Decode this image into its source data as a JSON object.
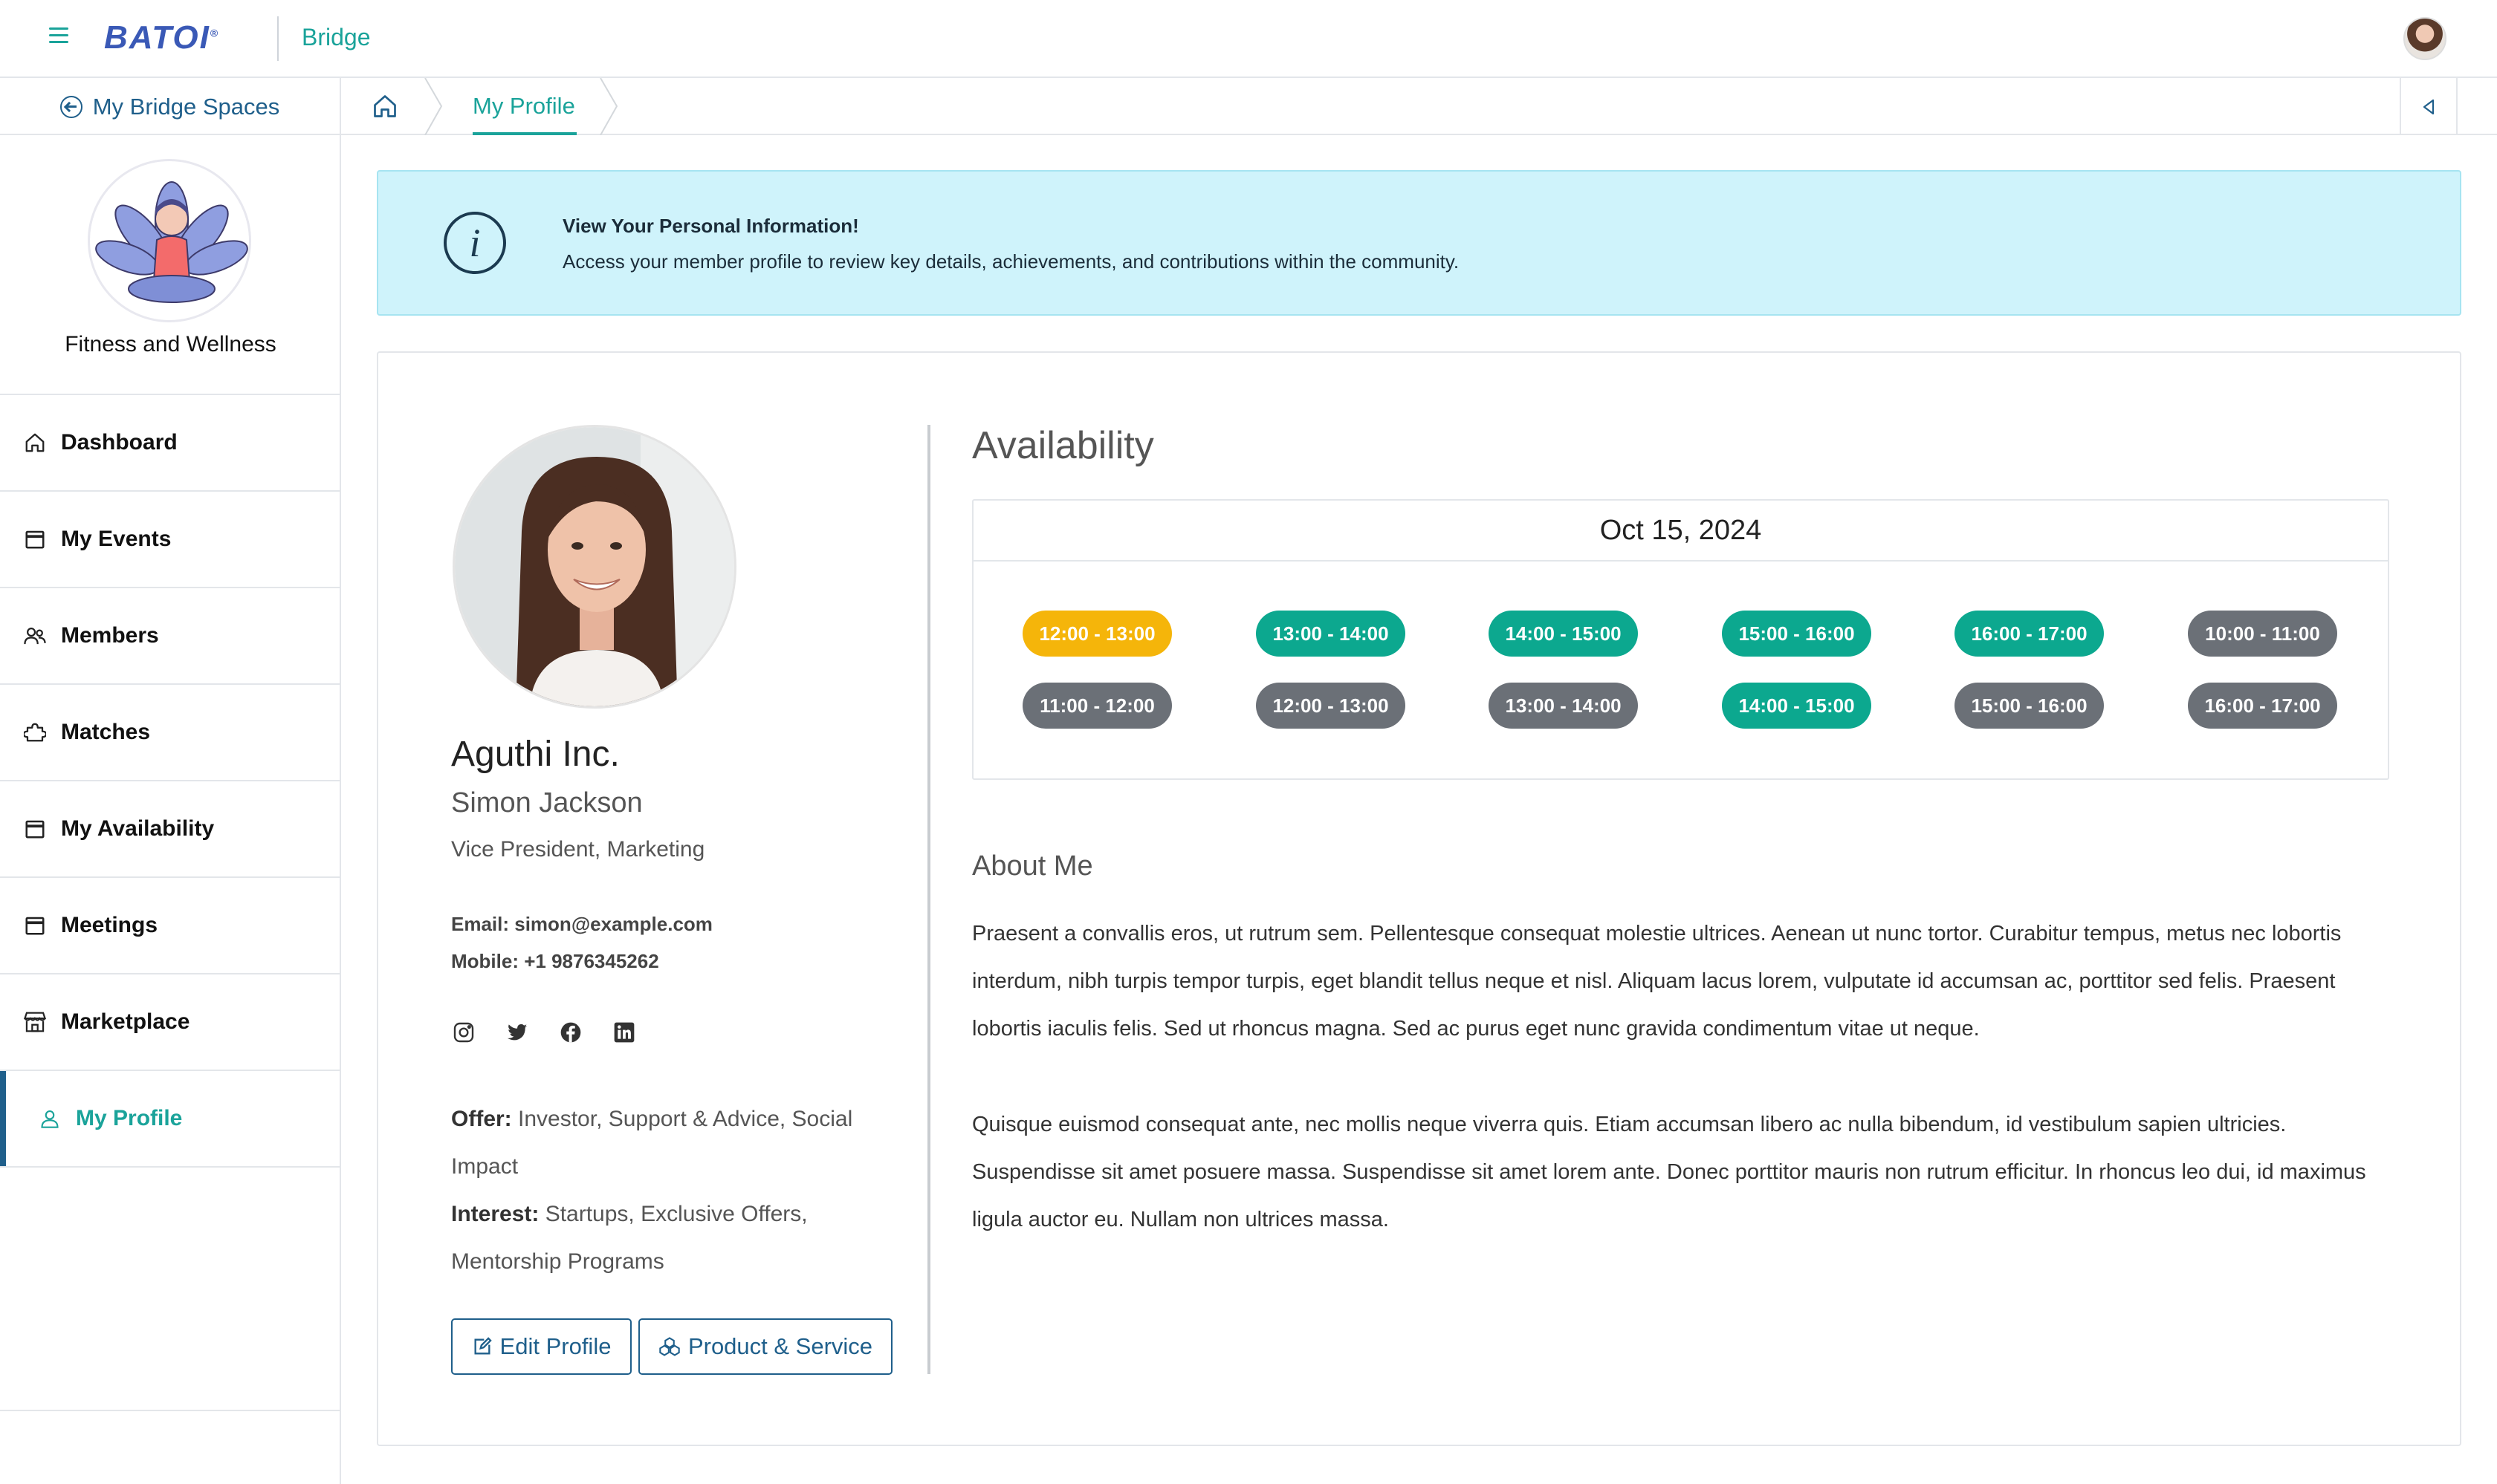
{
  "app": {
    "logo_text": "BATOI",
    "name": "Bridge"
  },
  "subbar": {
    "back_label": "My Bridge Spaces",
    "breadcrumb_current": "My Profile"
  },
  "sidebar": {
    "space_name": "Fitness and Wellness",
    "items": [
      {
        "label": "Dashboard",
        "icon": "home-icon"
      },
      {
        "label": "My Events",
        "icon": "calendar-icon"
      },
      {
        "label": "Members",
        "icon": "users-icon"
      },
      {
        "label": "Matches",
        "icon": "puzzle-icon"
      },
      {
        "label": "My Availability",
        "icon": "calendar-icon"
      },
      {
        "label": "Meetings",
        "icon": "calendar-icon"
      },
      {
        "label": "Marketplace",
        "icon": "store-icon"
      },
      {
        "label": "My Profile",
        "icon": "user-icon",
        "active": true
      }
    ]
  },
  "banner": {
    "title": "View Your Personal Information!",
    "text": "Access your member profile to review key details, achievements, and contributions within the community."
  },
  "profile": {
    "company": "Aguthi Inc.",
    "name": "Simon Jackson",
    "job_title": "Vice President, Marketing",
    "email": "Email: simon@example.com",
    "mobile": "Mobile: +1 9876345262",
    "socials": [
      "instagram-icon",
      "twitter-icon",
      "facebook-icon",
      "linkedin-icon"
    ],
    "offer_label": "Offer:",
    "offer_value": " Investor, Support & Advice, Social Impact",
    "interest_label": "Interest:",
    "interest_value": " Startups, Exclusive Offers, Mentorship Programs",
    "edit_button": "Edit Profile",
    "product_button": "Product & Service"
  },
  "availability": {
    "title": "Availability",
    "date": "Oct 15, 2024",
    "colors": {
      "selected": "#f5b50a",
      "available": "#0ca88f",
      "unavailable": "#6b7077"
    },
    "slots": [
      {
        "label": "12:00 - 13:00",
        "status": "selected"
      },
      {
        "label": "13:00 - 14:00",
        "status": "available"
      },
      {
        "label": "14:00 - 15:00",
        "status": "available"
      },
      {
        "label": "15:00 - 16:00",
        "status": "available"
      },
      {
        "label": "16:00 - 17:00",
        "status": "available"
      },
      {
        "label": "10:00 - 11:00",
        "status": "unavailable"
      },
      {
        "label": "11:00 - 12:00",
        "status": "unavailable"
      },
      {
        "label": "12:00 - 13:00",
        "status": "unavailable"
      },
      {
        "label": "13:00 - 14:00",
        "status": "unavailable"
      },
      {
        "label": "14:00 - 15:00",
        "status": "available"
      },
      {
        "label": "15:00 - 16:00",
        "status": "unavailable"
      },
      {
        "label": "16:00 - 17:00",
        "status": "unavailable"
      }
    ]
  },
  "about": {
    "title": "About Me",
    "paragraphs": [
      "Praesent a convallis eros, ut rutrum sem. Pellentesque consequat molestie ultrices. Aenean ut nunc tortor. Curabitur tempus, metus nec lobortis interdum, nibh turpis tempor turpis, eget blandit tellus neque et nisl. Aliquam lacus lorem, vulputate id accumsan ac, porttitor sed felis. Praesent lobortis iaculis felis. Sed ut rhoncus magna. Sed ac purus eget nunc gravida condimentum vitae ut neque.",
      "Quisque euismod consequat ante, nec mollis neque viverra quis. Etiam accumsan libero ac nulla bibendum, id vestibulum sapien ultricies. Suspendisse sit amet posuere massa. Suspendisse sit amet lorem ante. Donec porttitor mauris non rutrum efficitur. In rhoncus leo dui, id maximus ligula auctor eu. Nullam non ultrices massa."
    ]
  }
}
